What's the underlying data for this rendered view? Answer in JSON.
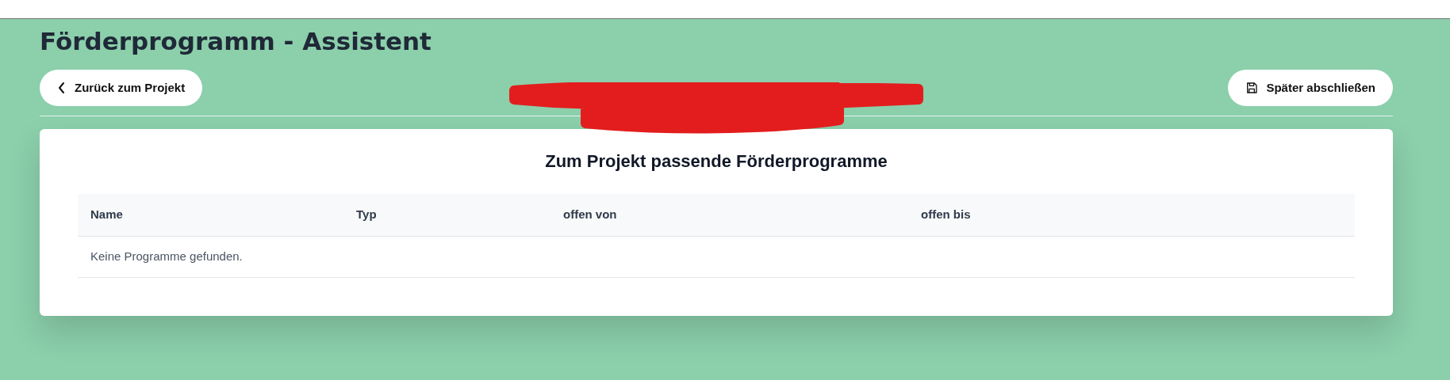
{
  "page_title": "Förderprogramm - Assistent",
  "back_button": {
    "label": "Zurück zum Projekt"
  },
  "save_button": {
    "label": "Später abschließen"
  },
  "card": {
    "title": "Zum Projekt passende Förderprogramme",
    "table": {
      "columns": [
        "Name",
        "Typ",
        "offen von",
        "offen bis"
      ],
      "empty_message": "Keine Programme gefunden."
    }
  }
}
